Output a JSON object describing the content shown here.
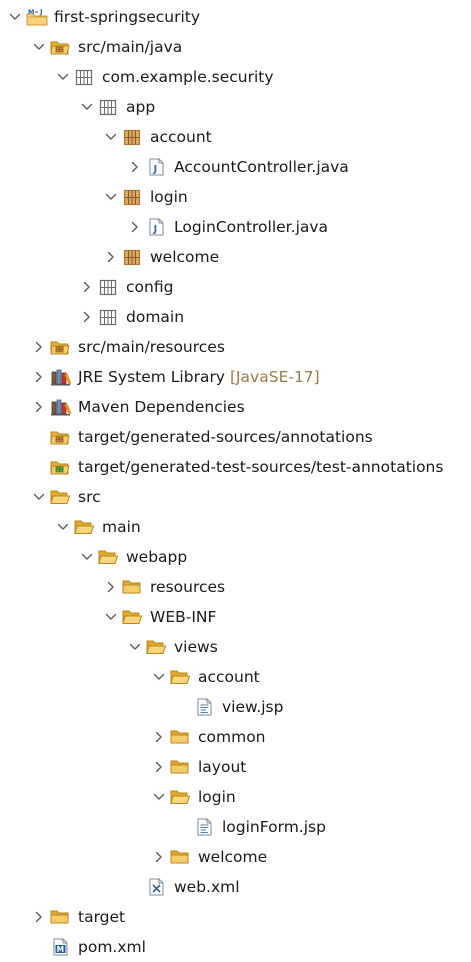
{
  "tree": {
    "rows": [
      {
        "label": "first-springsecurity",
        "depth": 0,
        "state": "open",
        "icon": "maven-project-icon"
      },
      {
        "label": "src/main/java",
        "depth": 1,
        "state": "open",
        "icon": "source-folder-icon"
      },
      {
        "label": "com.example.security",
        "depth": 2,
        "state": "open",
        "icon": "package-icon"
      },
      {
        "label": "app",
        "depth": 3,
        "state": "open",
        "icon": "package-icon"
      },
      {
        "label": "account",
        "depth": 4,
        "state": "open",
        "icon": "package-filled-icon"
      },
      {
        "label": "AccountController.java",
        "depth": 5,
        "state": "closed",
        "icon": "java-file-icon"
      },
      {
        "label": "login",
        "depth": 4,
        "state": "open",
        "icon": "package-filled-icon"
      },
      {
        "label": "LoginController.java",
        "depth": 5,
        "state": "closed",
        "icon": "java-file-icon"
      },
      {
        "label": "welcome",
        "depth": 4,
        "state": "closed",
        "icon": "package-filled-icon"
      },
      {
        "label": "config",
        "depth": 3,
        "state": "closed",
        "icon": "package-icon"
      },
      {
        "label": "domain",
        "depth": 3,
        "state": "closed",
        "icon": "package-icon"
      },
      {
        "label": "src/main/resources",
        "depth": 1,
        "state": "closed",
        "icon": "source-folder-icon"
      },
      {
        "label": "JRE System Library",
        "decoration": "[JavaSE-17]",
        "depth": 1,
        "state": "closed",
        "icon": "library-icon"
      },
      {
        "label": "Maven Dependencies",
        "depth": 1,
        "state": "closed",
        "icon": "library-icon"
      },
      {
        "label": "target/generated-sources/annotations",
        "depth": 1,
        "state": "none",
        "icon": "source-folder-icon"
      },
      {
        "label": "target/generated-test-sources/test-annotations",
        "depth": 1,
        "state": "none",
        "icon": "test-source-folder-icon"
      },
      {
        "label": "src",
        "depth": 1,
        "state": "open",
        "icon": "folder-open-icon"
      },
      {
        "label": "main",
        "depth": 2,
        "state": "open",
        "icon": "folder-open-icon"
      },
      {
        "label": "webapp",
        "depth": 3,
        "state": "open",
        "icon": "folder-open-icon"
      },
      {
        "label": "resources",
        "depth": 4,
        "state": "closed",
        "icon": "folder-icon"
      },
      {
        "label": "WEB-INF",
        "depth": 4,
        "state": "open",
        "icon": "folder-open-icon"
      },
      {
        "label": "views",
        "depth": 5,
        "state": "open",
        "icon": "folder-open-icon"
      },
      {
        "label": "account",
        "depth": 6,
        "state": "open",
        "icon": "folder-open-icon"
      },
      {
        "label": "view.jsp",
        "depth": 7,
        "state": "none",
        "icon": "jsp-file-icon"
      },
      {
        "label": "common",
        "depth": 6,
        "state": "closed",
        "icon": "folder-icon"
      },
      {
        "label": "layout",
        "depth": 6,
        "state": "closed",
        "icon": "folder-icon"
      },
      {
        "label": "login",
        "depth": 6,
        "state": "open",
        "icon": "folder-open-icon"
      },
      {
        "label": "loginForm.jsp",
        "depth": 7,
        "state": "none",
        "icon": "jsp-file-icon"
      },
      {
        "label": "welcome",
        "depth": 6,
        "state": "closed",
        "icon": "folder-icon"
      },
      {
        "label": "web.xml",
        "depth": 5,
        "state": "none",
        "icon": "xml-file-icon"
      },
      {
        "label": "target",
        "depth": 1,
        "state": "closed",
        "icon": "folder-icon"
      },
      {
        "label": "pom.xml",
        "depth": 1,
        "state": "none",
        "icon": "maven-pom-icon"
      }
    ]
  },
  "colors": {
    "text": "#1a1a1a",
    "decoration": "#9a7b4a",
    "toggle": "#5a5a5a",
    "folder": "#e5b23a",
    "package": "#6b6b6b",
    "package_filled": "#b07a3c",
    "java": "#3a6ea5",
    "jsp": "#5b7fa8",
    "maven": "#1f5fa8",
    "library": "#6e8fb5"
  }
}
